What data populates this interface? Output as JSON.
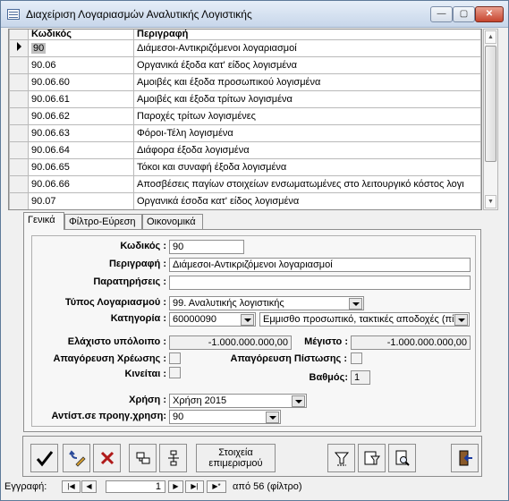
{
  "window": {
    "title": "Διαχείριση Λογαριασμών Αναλυτικής Λογιστικής",
    "min": "—",
    "max": "▢",
    "close": "✕"
  },
  "grid": {
    "headers": [
      "Κωδικός",
      "Περιγραφή"
    ],
    "rows": [
      {
        "code": "90",
        "desc": "Διάμεσοι-Αντικριζόμενοι λογαριασμοί"
      },
      {
        "code": "90.06",
        "desc": "Οργανικά έξοδα κατ' είδος λογισμένα"
      },
      {
        "code": "90.06.60",
        "desc": "Αμοιβές και έξοδα προσωπικού λογισμένα"
      },
      {
        "code": "90.06.61",
        "desc": "Αμοιβές και έξοδα τρίτων λογισμένα"
      },
      {
        "code": "90.06.62",
        "desc": "Παροχές τρίτων λογισμένες"
      },
      {
        "code": "90.06.63",
        "desc": "Φόροι-Τέλη λογισμένα"
      },
      {
        "code": "90.06.64",
        "desc": "Διάφορα έξοδα λογισμένα"
      },
      {
        "code": "90.06.65",
        "desc": "Τόκοι και συναφή έξοδα λογισμένα"
      },
      {
        "code": "90.06.66",
        "desc": "Αποσβέσεις παγίων στοιχείων ενσωματωμένες στο λειτουργικό κόστος λογι"
      },
      {
        "code": "90.07",
        "desc": "Οργανικά έσοδα κατ' είδος λογισμένα"
      }
    ]
  },
  "tabs": [
    "Γενικά",
    "Φίλτρο-Εύρεση",
    "Οικονομικά"
  ],
  "form": {
    "code_label": "Κωδικός :",
    "code": "90",
    "desc_label": "Περιγραφή :",
    "desc": "Διάμεσοι-Αντικριζόμενοι λογαριασμοί",
    "notes_label": "Παρατηρήσεις :",
    "notes": "",
    "type_label": "Τύπος Λογαριασμού :",
    "type": "99. Αναλυτικής λογιστικής",
    "category_label": "Κατηγορία :",
    "category_code": "60000090",
    "category_desc": "Εμμισθο προσωπικό, τακτικές αποδοχές (πί",
    "min_label": "Ελάχιστο υπόλοιπο :",
    "min": "-1.000.000.000,00",
    "max_label": "Μέγιστο :",
    "max": "-1.000.000.000,00",
    "debit_block_label": "Απαγόρευση Χρέωσης :",
    "credit_block_label": "Απαγόρευση Πίστωσης :",
    "moves_label": "Κινείται :",
    "degree_label": "Βαθμός:",
    "degree": "1",
    "year_label": "Χρήση :",
    "year": "Χρήση 2015",
    "prev_label": "Αντίστ.σε προηγ.χρηση:",
    "prev": "90"
  },
  "toolbar": {
    "details_line1": "Στοιχεία",
    "details_line2": "επιμερισμού"
  },
  "status": {
    "record_label": "Εγγραφή:",
    "current": "1",
    "total_text": "από  56 (φίλτρο)"
  },
  "colors": {
    "close_button": "#c7452f",
    "titlebar": "#c7d6ea"
  }
}
